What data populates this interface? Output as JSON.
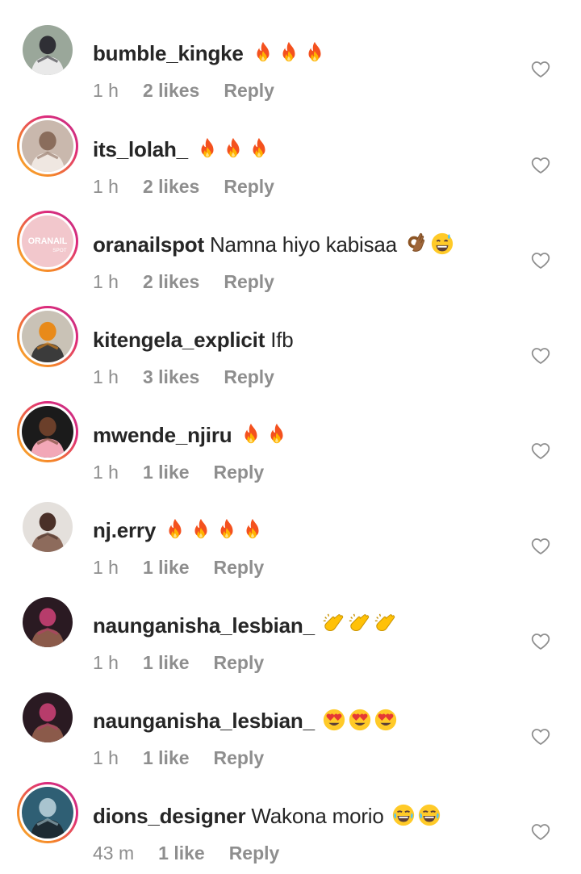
{
  "comments": [
    {
      "username": "bumble_kingke",
      "text": "",
      "emojis": [
        "fire",
        "fire",
        "fire"
      ],
      "time": "1 h",
      "likes": "2 likes",
      "reply": "Reply",
      "story_ring": false,
      "avatar_colors": [
        "#9aa79a",
        "#2f2f35",
        "#e9e9e9"
      ]
    },
    {
      "username": "its_lolah_",
      "text": "",
      "emojis": [
        "fire",
        "fire",
        "fire"
      ],
      "time": "1 h",
      "likes": "2 likes",
      "reply": "Reply",
      "story_ring": true,
      "avatar_colors": [
        "#c9b8ad",
        "#8a6d5c",
        "#efe7e1"
      ]
    },
    {
      "username": "oranailspot",
      "text": "Namna hiyo kabisaa",
      "emojis": [
        "ok-hand",
        "grinning-sweat"
      ],
      "time": "1 h",
      "likes": "2 likes",
      "reply": "Reply",
      "story_ring": true,
      "avatar_colors": [
        "#f2c7cc",
        "#ffffff",
        "#e7a8b0"
      ],
      "avatar_text": "ORANAIL SPOT"
    },
    {
      "username": "kitengela_explicit",
      "text": "Ifb",
      "emojis": [],
      "time": "1 h",
      "likes": "3 likes",
      "reply": "Reply",
      "story_ring": true,
      "avatar_colors": [
        "#c9c2b6",
        "#e88a1a",
        "#3b3b3b"
      ]
    },
    {
      "username": "mwende_njiru",
      "text": "",
      "emojis": [
        "fire",
        "fire"
      ],
      "time": "1 h",
      "likes": "1 like",
      "reply": "Reply",
      "story_ring": true,
      "avatar_colors": [
        "#1b1b1b",
        "#6b3f2a",
        "#f2a7b7"
      ]
    },
    {
      "username": "nj.erry",
      "text": "",
      "emojis": [
        "fire",
        "fire",
        "fire",
        "fire"
      ],
      "time": "1 h",
      "likes": "1 like",
      "reply": "Reply",
      "story_ring": false,
      "avatar_colors": [
        "#e4e0dc",
        "#4a3028",
        "#8d6b5c"
      ]
    },
    {
      "username": "naunganisha_lesbian_",
      "text": "",
      "emojis": [
        "clap",
        "clap",
        "clap"
      ],
      "time": "1 h",
      "likes": "1 like",
      "reply": "Reply",
      "story_ring": false,
      "avatar_colors": [
        "#2a1a22",
        "#b73c6b",
        "#8b5a4a"
      ]
    },
    {
      "username": "naunganisha_lesbian_",
      "text": "",
      "emojis": [
        "heart-eyes",
        "heart-eyes",
        "heart-eyes"
      ],
      "time": "1 h",
      "likes": "1 like",
      "reply": "Reply",
      "story_ring": false,
      "avatar_colors": [
        "#2a1a22",
        "#b73c6b",
        "#8b5a4a"
      ]
    },
    {
      "username": "dions_designer",
      "text": "Wakona morio",
      "emojis": [
        "joy",
        "joy"
      ],
      "time": "43 m",
      "likes": "1 like",
      "reply": "Reply",
      "story_ring": true,
      "avatar_colors": [
        "#2f5f74",
        "#a9c4cf",
        "#1d2b33"
      ]
    }
  ],
  "colors": {
    "text_primary": "#262626",
    "text_secondary": "#8e8e8e",
    "story_gradient": [
      "#f9b233",
      "#f58529",
      "#dd2a7b",
      "#c13584"
    ]
  }
}
